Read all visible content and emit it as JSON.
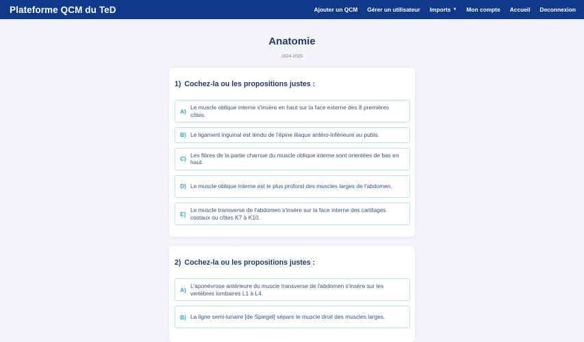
{
  "navbar": {
    "brand": "Plateforme QCM du TeD",
    "items": [
      {
        "label": "Ajouter un QCM"
      },
      {
        "label": "Gérer un utilisateur"
      },
      {
        "label": "Imports"
      },
      {
        "label": "Mon compte"
      },
      {
        "label": "Accueil"
      },
      {
        "label": "Deconnexion"
      }
    ]
  },
  "page": {
    "title": "Anatomie",
    "year": "2024-2025"
  },
  "questions": [
    {
      "number": "1)",
      "prompt": "Cochez-la ou les propositions justes :",
      "options": [
        {
          "letter": "A)",
          "text": "Le muscle oblique interne s'insère en haut sur la face externe des 8 premières côtes."
        },
        {
          "letter": "B)",
          "text": "Le ligament inguinal est tendu de l'épine iliaque antéro-inférieure au pubis."
        },
        {
          "letter": "C)",
          "text": "Les fibres de la partie charnue du muscle oblique interne sont orientées de bas en haut."
        },
        {
          "letter": "D)",
          "text": "Le muscle oblique interne est le plus profond des muscles larges de l'abdomen."
        },
        {
          "letter": "E)",
          "text": "Le muscle transverse de l'abdomen s'insère sur la face interne des cartilages costaux ou côtes K7 à K10."
        }
      ]
    },
    {
      "number": "2)",
      "prompt": "Cochez-la ou les propositions justes :",
      "options": [
        {
          "letter": "A)",
          "text": "L'aponévrose antérieure du muscle transverse de l'abdomen s'insère sur les vertèbres lombaires L1 à L4."
        },
        {
          "letter": "B)",
          "text": "La ligne semi-lunaire [de Spiegel] sépare le muscle droit des muscles larges."
        }
      ]
    }
  ]
}
